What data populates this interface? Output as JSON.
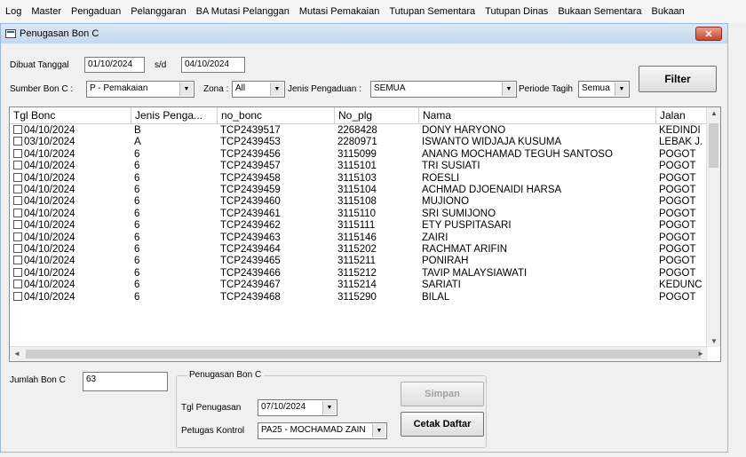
{
  "menu": [
    "Log",
    "Master",
    "Pengaduan",
    "Pelanggaran",
    "BA Mutasi Pelanggan",
    "Mutasi Pemakaian",
    "Tutupan Sementara",
    "Tutupan Dinas",
    "Bukaan Sementara",
    "Bukaan"
  ],
  "window": {
    "title": "Penugasan Bon C",
    "close_label": "✕"
  },
  "filters": {
    "dibuat_label": "Dibuat Tanggal",
    "date_from": "01/10/2024",
    "sd_label": "s/d",
    "date_to": "04/10/2024",
    "sumber_label": "Sumber Bon C :",
    "sumber_value": "P - Pemakaian",
    "zona_label": "Zona :",
    "zona_value": "All",
    "jenis_label": "Jenis Pengaduan :",
    "jenis_value": "SEMUA",
    "periode_label": "Periode Tagih",
    "periode_value": "Semua",
    "filter_button": "Filter"
  },
  "table": {
    "columns": [
      "Tgl Bonc",
      "Jenis Penga...",
      "no_bonc",
      "No_plg",
      "Nama",
      "Jalan"
    ],
    "rows": [
      [
        "04/10/2024",
        "B",
        "TCP2439517",
        "2268428",
        "DONY HARYONO",
        "KEDINDI"
      ],
      [
        "03/10/2024",
        "A",
        "TCP2439453",
        "2280971",
        "ISWANTO WIDJAJA KUSUMA",
        "LEBAK J."
      ],
      [
        "04/10/2024",
        "6",
        "TCP2439456",
        "3115099",
        "ANANG MOCHAMAD TEGUH SANTOSO",
        "POGOT"
      ],
      [
        "04/10/2024",
        "6",
        "TCP2439457",
        "3115101",
        "TRI SUSIATI",
        "POGOT"
      ],
      [
        "04/10/2024",
        "6",
        "TCP2439458",
        "3115103",
        "ROESLI",
        "POGOT"
      ],
      [
        "04/10/2024",
        "6",
        "TCP2439459",
        "3115104",
        "ACHMAD DJOENAIDI HARSA",
        "POGOT"
      ],
      [
        "04/10/2024",
        "6",
        "TCP2439460",
        "3115108",
        "MUJIONO",
        "POGOT"
      ],
      [
        "04/10/2024",
        "6",
        "TCP2439461",
        "3115110",
        "SRI SUMIJONO",
        "POGOT"
      ],
      [
        "04/10/2024",
        "6",
        "TCP2439462",
        "3115111",
        "ETY PUSPITASARI",
        "POGOT"
      ],
      [
        "04/10/2024",
        "6",
        "TCP2439463",
        "3115146",
        "ZAIRI",
        "POGOT"
      ],
      [
        "04/10/2024",
        "6",
        "TCP2439464",
        "3115202",
        "RACHMAT ARIFIN",
        "POGOT"
      ],
      [
        "04/10/2024",
        "6",
        "TCP2439465",
        "3115211",
        "PONIRAH",
        "POGOT"
      ],
      [
        "04/10/2024",
        "6",
        "TCP2439466",
        "3115212",
        "TAVIP MALAYSIAWATI",
        "POGOT"
      ],
      [
        "04/10/2024",
        "6",
        "TCP2439467",
        "3115214",
        "SARIATI",
        "KEDUNC"
      ],
      [
        "04/10/2024",
        "6",
        "TCP2439468",
        "3115290",
        "BILAL",
        "POGOT"
      ]
    ]
  },
  "footer": {
    "jumlah_label": "Jumlah Bon C",
    "jumlah_value": "63",
    "group_title": "Penugasan Bon C",
    "tgl_label": "Tgl Penugasan",
    "tgl_value": "07/10/2024",
    "petugas_label": "Petugas Kontrol",
    "petugas_value": "PA25 - MOCHAMAD ZAIN",
    "simpan_button": "Simpan",
    "cetak_button": "Cetak Daftar"
  },
  "icons": {
    "checkbox": "checkbox-icon",
    "dropdown": "chevron-down-icon"
  }
}
